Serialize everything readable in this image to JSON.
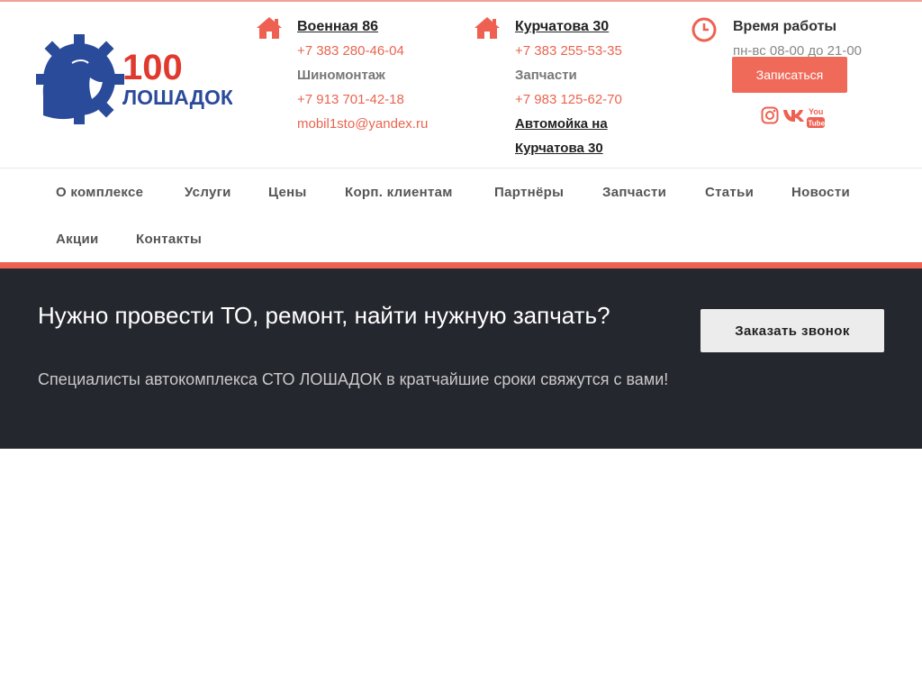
{
  "colors": {
    "accent": "#ee6152",
    "dark_band": "#25272e",
    "logo_blue": "#2a4a9a",
    "logo_red": "#e03a2f"
  },
  "logo": {
    "number": "100",
    "word": "ЛОШАДОК"
  },
  "contacts": {
    "voennaya": {
      "icon": "home-icon",
      "address": "Военная 86",
      "phone1": "+7 383 280-46-04",
      "label": "Шиномонтаж",
      "phone2": "+7 913 701-42-18",
      "email": "mobil1sto@yandex.ru"
    },
    "kurchatova": {
      "icon": "home-icon",
      "address": "Курчатова 30",
      "phone1": "+7 383 255-53-35",
      "label": "Запчасти",
      "phone2": "+7 983 125-62-70",
      "carwash_line1": "Автомойка на",
      "carwash_line2": "Курчатова 30"
    },
    "hours": {
      "icon": "clock-icon",
      "title": "Время работы",
      "text": "пн-вс 08-00 до 21-00",
      "button": "Записаться"
    }
  },
  "socials": [
    {
      "name": "instagram-icon"
    },
    {
      "name": "vk-icon"
    },
    {
      "name": "youtube-icon",
      "text_top": "You",
      "text_bottom": "Tube"
    }
  ],
  "nav": {
    "items": [
      "О комплексе",
      "Услуги",
      "Цены",
      "Корп. клиентам",
      "Партнёры",
      "Запчасти",
      "Статьи",
      "Новости",
      "Акции",
      "Контакты"
    ]
  },
  "cta": {
    "title": "Нужно провести ТО, ремонт, найти нужную запчать?",
    "subtitle": "Специалисты автокомплекса СТО ЛОШАДОК в кратчайшие сроки свяжутся с вами!",
    "button": "Заказать звонок"
  }
}
